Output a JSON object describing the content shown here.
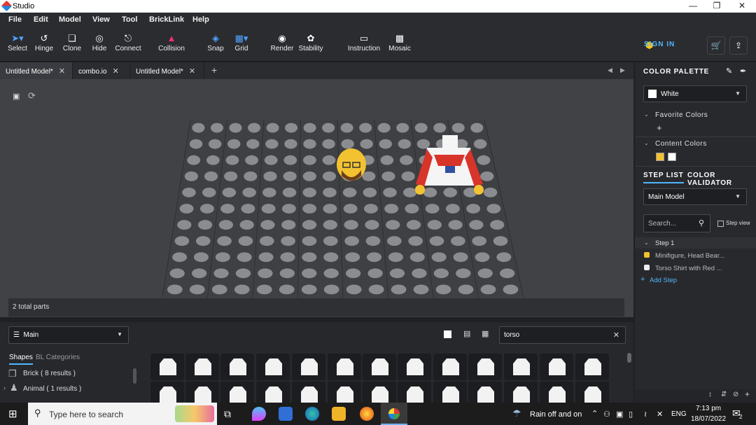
{
  "window": {
    "title": "Studio"
  },
  "menu": [
    "File",
    "Edit",
    "Model",
    "View",
    "Tool",
    "BrickLink",
    "Help"
  ],
  "toolbar": {
    "tools": [
      {
        "label": "Select",
        "icon": "pointer-icon"
      },
      {
        "label": "Hinge",
        "icon": "hinge-icon"
      },
      {
        "label": "Clone",
        "icon": "clone-icon"
      },
      {
        "label": "Hide",
        "icon": "hide-icon"
      },
      {
        "label": "Connect",
        "icon": "connect-icon"
      },
      {
        "label": "Collision",
        "icon": "collision-icon"
      },
      {
        "label": "Snap",
        "icon": "snap-icon"
      },
      {
        "label": "Grid",
        "icon": "grid-icon"
      },
      {
        "label": "Render",
        "icon": "camera-icon"
      },
      {
        "label": "Stability",
        "icon": "stability-icon"
      },
      {
        "label": "Instruction",
        "icon": "instruction-icon"
      },
      {
        "label": "Mosaic",
        "icon": "mosaic-icon"
      }
    ],
    "sign_in": "SIGN IN"
  },
  "tabs": [
    {
      "label": "Untitled Model*"
    },
    {
      "label": "combo.io"
    },
    {
      "label": "Untitled Model*"
    }
  ],
  "viewport": {
    "parts_count": "2 total parts"
  },
  "bottom": {
    "model_select": "Main",
    "search_value": "torso",
    "tab_shapes": "Shapes",
    "tab_bl": "BL Categories",
    "categories": [
      {
        "label": "Brick ( 8 results )"
      },
      {
        "label": "Animal ( 1 results )"
      }
    ]
  },
  "right": {
    "color_palette_title": "COLOR PALETTE",
    "selected_color": "White",
    "favorite_colors": "Favorite Colors",
    "content_colors": "Content Colors",
    "content_swatches": [
      "#f2c230",
      "#ffffff"
    ],
    "step_list_tab": "STEP LIST",
    "color_validator_tab": "COLOR VALIDATOR",
    "model_select": "Main Model",
    "search_placeholder": "Search...",
    "step_view": "Step view",
    "step_title": "Step 1",
    "step_items": [
      "Minifigure, Head Bear...",
      "Torso Shirt with Red ..."
    ],
    "add_step": "Add Step"
  },
  "taskbar": {
    "search_placeholder": "Type here to search",
    "weather": "Rain off and on",
    "lang": "ENG",
    "time": "7:13 pm",
    "date": "18/07/2022",
    "notifications": "2"
  }
}
